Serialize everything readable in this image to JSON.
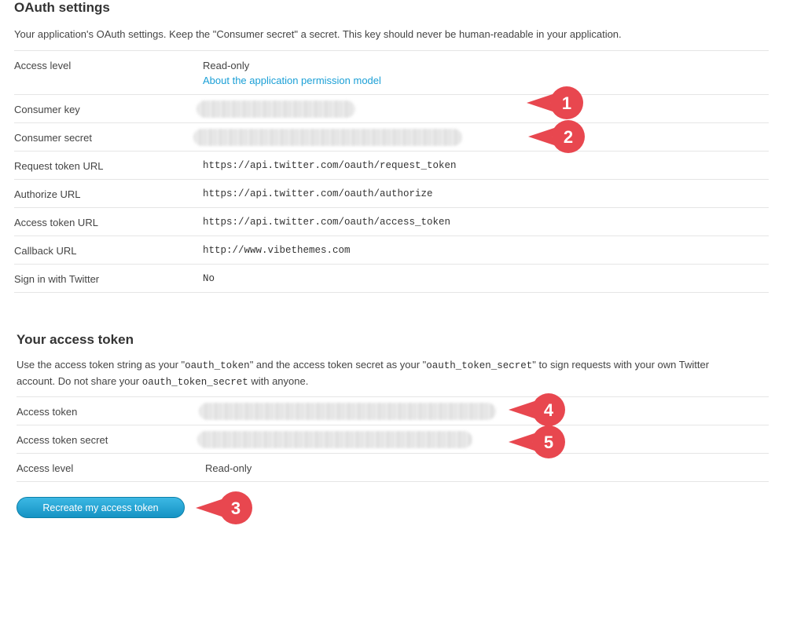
{
  "oauth": {
    "title": "OAuth settings",
    "description": "Your application's OAuth settings. Keep the \"Consumer secret\" a secret. This key should never be human-readable in your application.",
    "rows": [
      {
        "label": "Access level",
        "value": "Read-only",
        "link": "About the application permission model"
      },
      {
        "label": "Consumer key",
        "value": ""
      },
      {
        "label": "Consumer secret",
        "value": ""
      },
      {
        "label": "Request token URL",
        "value": "https://api.twitter.com/oauth/request_token"
      },
      {
        "label": "Authorize URL",
        "value": "https://api.twitter.com/oauth/authorize"
      },
      {
        "label": "Access token URL",
        "value": "https://api.twitter.com/oauth/access_token"
      },
      {
        "label": "Callback URL",
        "value": "http://www.vibethemes.com"
      },
      {
        "label": "Sign in with Twitter",
        "value": "No"
      }
    ]
  },
  "token": {
    "title": "Your access token",
    "description_part1": "Use the access token string as your \"",
    "code1": "oauth_token",
    "description_part2": "\" and the access token secret as your \"",
    "code2": "oauth_token_secret",
    "description_part3": "\" to sign requests with your own Twitter account. Do not share your ",
    "code3": "oauth_token_secret",
    "description_part4": " with anyone.",
    "rows": [
      {
        "label": "Access token",
        "value": ""
      },
      {
        "label": "Access token secret",
        "value": ""
      },
      {
        "label": "Access level",
        "value": "Read-only"
      }
    ],
    "button_label": "Recreate my access token"
  },
  "markers": [
    "1",
    "2",
    "3",
    "4",
    "5"
  ],
  "colors": {
    "marker": "#e8474f",
    "link": "#1a9fd6",
    "button": "#1593c4"
  }
}
